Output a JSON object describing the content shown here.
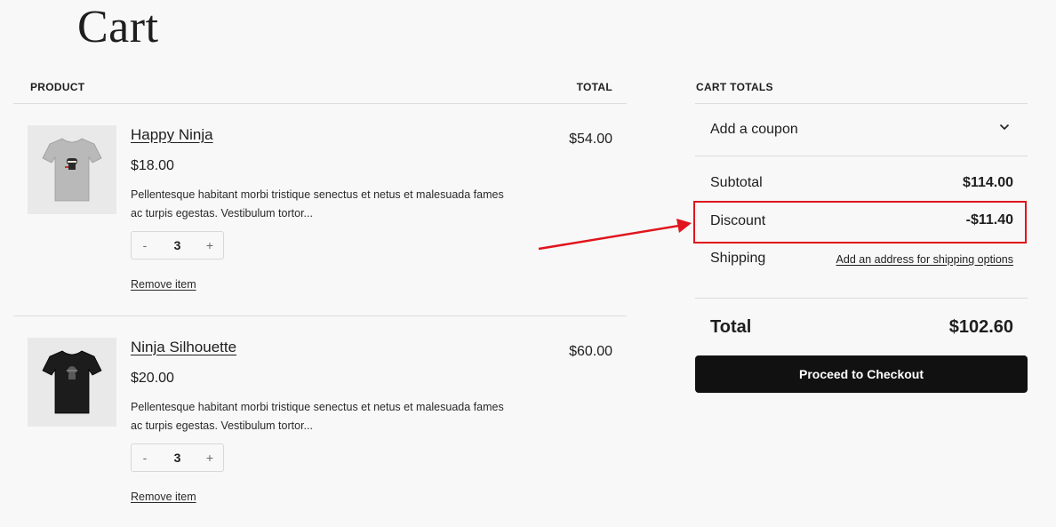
{
  "page": {
    "title": "Cart"
  },
  "table": {
    "product_header": "PRODUCT",
    "total_header": "TOTAL"
  },
  "items": [
    {
      "name": "Happy Ninja",
      "price": "$18.00",
      "description": "Pellentesque habitant morbi tristique senectus et netus et malesuada fames ac turpis egestas. Vestibulum tortor...",
      "quantity": "3",
      "minus": "-",
      "plus": "+",
      "remove_label": "Remove item",
      "line_total": "$54.00",
      "shirt_color": "#b9b9b9"
    },
    {
      "name": "Ninja Silhouette",
      "price": "$20.00",
      "description": "Pellentesque habitant morbi tristique senectus et netus et malesuada fames ac turpis egestas. Vestibulum tortor...",
      "quantity": "3",
      "minus": "-",
      "plus": "+",
      "remove_label": "Remove item",
      "line_total": "$60.00",
      "shirt_color": "#1c1c1c"
    }
  ],
  "totals": {
    "header": "CART TOTALS",
    "coupon_label": "Add a coupon",
    "subtotal_label": "Subtotal",
    "subtotal_value": "$114.00",
    "discount_label": "Discount",
    "discount_value": "-$11.40",
    "shipping_label": "Shipping",
    "shipping_link": "Add an address for shipping options",
    "total_label": "Total",
    "total_value": "$102.60",
    "checkout_label": "Proceed to Checkout"
  },
  "colors": {
    "annotation": "#e0141c",
    "checkout_bg": "#111111",
    "page_bg": "#f8f8f8"
  }
}
